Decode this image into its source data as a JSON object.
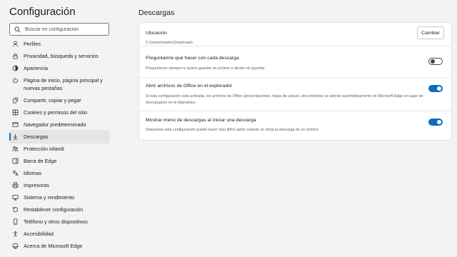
{
  "sidebar": {
    "title": "Configuración",
    "search_placeholder": "Buscar en configuración",
    "items": [
      {
        "label": "Perfiles",
        "icon": "profile-icon"
      },
      {
        "label": "Privacidad, búsqueda y servicios",
        "icon": "lock-icon"
      },
      {
        "label": "Apariencia",
        "icon": "appearance-icon"
      },
      {
        "label": "Página de inicio, página principal y nuevas pestañas",
        "icon": "power-icon"
      },
      {
        "label": "Compartir, copiar y pegar",
        "icon": "share-icon"
      },
      {
        "label": "Cookies y permisos del sitio",
        "icon": "cookies-icon"
      },
      {
        "label": "Navegador predeterminado",
        "icon": "browser-icon"
      },
      {
        "label": "Descargas",
        "icon": "download-icon",
        "active": true
      },
      {
        "label": "Protección infantil",
        "icon": "family-icon"
      },
      {
        "label": "Barra de Edge",
        "icon": "sidebar-icon"
      },
      {
        "label": "Idiomas",
        "icon": "languages-icon"
      },
      {
        "label": "Impresoras",
        "icon": "printer-icon"
      },
      {
        "label": "Sistema y rendimiento",
        "icon": "system-icon"
      },
      {
        "label": "Restablecer configuración",
        "icon": "reset-icon"
      },
      {
        "label": "Teléfono y otros dispositivos",
        "icon": "phone-icon"
      },
      {
        "label": "Accesibilidad",
        "icon": "accessibility-icon"
      },
      {
        "label": "Acerca de Microsoft Edge",
        "icon": "edge-icon"
      }
    ]
  },
  "main": {
    "title": "Descargas",
    "location": {
      "title": "Ubicación",
      "path": "C:\\Users\\manhu\\Downloads",
      "button": "Cambiar"
    },
    "settings": [
      {
        "title": "Preguntarme qué hacer con cada descarga",
        "desc": "Preguntarme siempre si quiero guardar un archivo o abrirlo sin guardar",
        "on": false
      },
      {
        "title": "Abrir archivos de Office en el explorador",
        "desc": "Si esta configuración está activada, los archivos de Office (presentaciones, hojas de cálculo, documentos) se abrirán automáticamente en Microsoft Edge en lugar de descargarlos en el dispositivo.",
        "on": true
      },
      {
        "title": "Mostrar menú de descargas al iniciar una descarga",
        "desc": "Desactivar esta configuración puede hacer más difícil saber cuando se inicia la descarga de un archivo",
        "on": true
      }
    ]
  },
  "colors": {
    "accent": "#0f6cbd",
    "background": "#f3f3f3",
    "card": "#ffffff"
  }
}
